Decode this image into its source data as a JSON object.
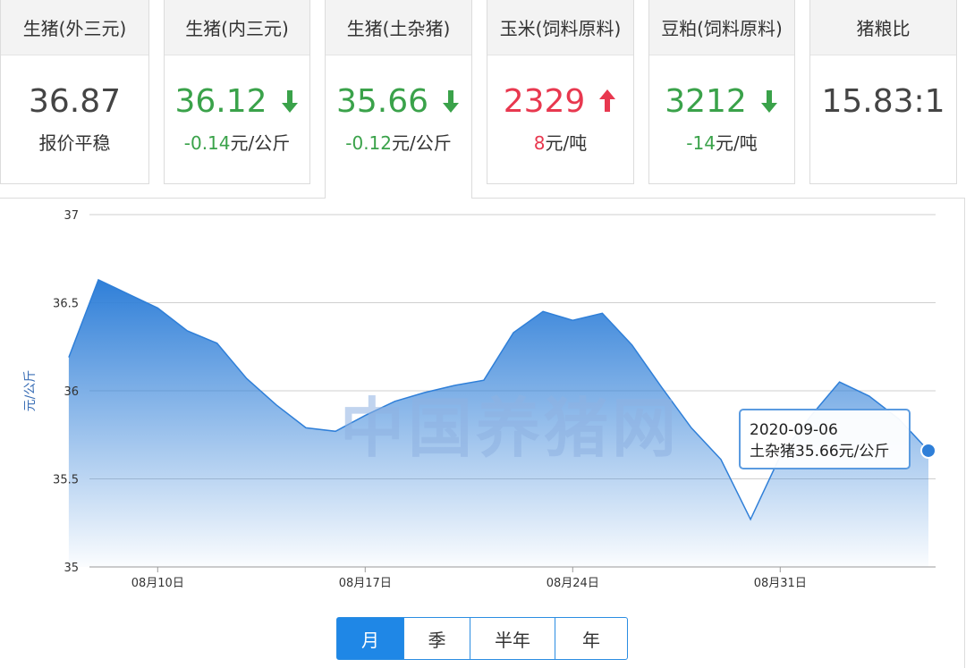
{
  "tabs": [
    {
      "label": "生猪(外三元)",
      "value": "36.87",
      "trend": "flat",
      "sub_change": "",
      "sub_text": "报价平稳",
      "active": false
    },
    {
      "label": "生猪(内三元)",
      "value": "36.12",
      "trend": "down",
      "sub_change": "-0.14",
      "sub_text": "元/公斤",
      "active": false
    },
    {
      "label": "生猪(土杂猪)",
      "value": "35.66",
      "trend": "down",
      "sub_change": "-0.12",
      "sub_text": "元/公斤",
      "active": true
    },
    {
      "label": "玉米(饲料原料)",
      "value": "2329",
      "trend": "up",
      "sub_change": "8",
      "sub_text": "元/吨",
      "active": false
    },
    {
      "label": "豆粕(饲料原料)",
      "value": "3212",
      "trend": "down",
      "sub_change": "-14",
      "sub_text": "元/吨",
      "active": false
    },
    {
      "label": "猪粮比",
      "value": "15.83:1",
      "trend": "flat",
      "sub_change": "",
      "sub_text": "",
      "active": false
    }
  ],
  "colors": {
    "down": "#3aa24a",
    "up": "#e8384f",
    "accent": "#1f87e6",
    "area": "#2f7fd8"
  },
  "watermark": "中国养猪网",
  "tooltip": {
    "date": "2020-09-06",
    "text": "土杂猪35.66元/公斤"
  },
  "ranges": [
    {
      "label": "月",
      "active": true
    },
    {
      "label": "季",
      "active": false
    },
    {
      "label": "半年",
      "active": false
    },
    {
      "label": "年",
      "active": false
    }
  ],
  "chart_data": {
    "type": "area",
    "ylabel": "元/公斤",
    "ylim": [
      35,
      37
    ],
    "yticks": [
      35,
      35.5,
      36,
      36.5,
      37
    ],
    "xlim": [
      0,
      28
    ],
    "x_ticks": [
      {
        "x": 2,
        "label": "08月10日"
      },
      {
        "x": 9,
        "label": "08月17日"
      },
      {
        "x": 16,
        "label": "08月24日"
      },
      {
        "x": 23,
        "label": "08月31日"
      }
    ],
    "dates": [
      "08-08",
      "08-09",
      "08-10",
      "08-11",
      "08-12",
      "08-13",
      "08-14",
      "08-15",
      "08-16",
      "08-17",
      "08-18",
      "08-19",
      "08-20",
      "08-21",
      "08-22",
      "08-23",
      "08-24",
      "08-25",
      "08-26",
      "08-27",
      "08-28",
      "08-29",
      "08-30",
      "08-31",
      "09-01",
      "09-02",
      "09-03",
      "09-04",
      "09-05",
      "09-06"
    ],
    "series": [
      {
        "values": [
          36.19,
          36.63,
          36.55,
          36.47,
          36.34,
          36.27,
          36.07,
          35.92,
          35.79,
          35.77,
          35.86,
          35.94,
          35.99,
          36.03,
          36.06,
          36.33,
          36.45,
          36.4,
          36.44,
          36.26,
          36.02,
          35.79,
          35.61,
          35.27,
          35.63,
          35.85,
          36.05,
          35.97,
          35.84,
          35.66
        ]
      }
    ],
    "highlight_index": 29
  }
}
